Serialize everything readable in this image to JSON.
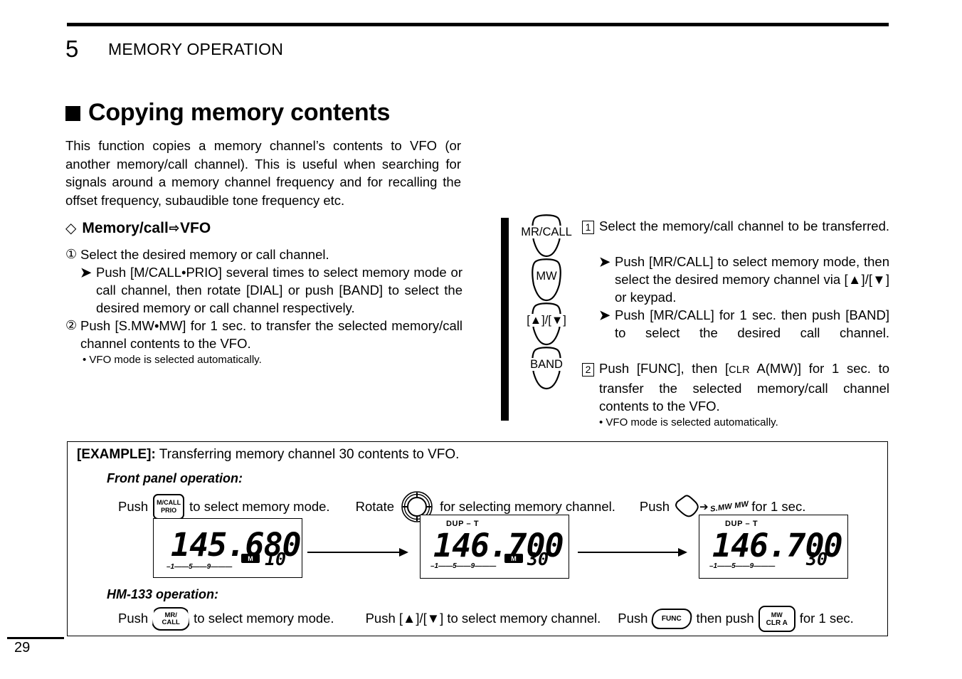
{
  "header": {
    "chapter_number": "5",
    "chapter_title": "MEMORY OPERATION"
  },
  "heading": "Copying memory contents",
  "intro": "This function copies a memory channel’s contents to VFO (or another memory/call channel). This is useful when searching for signals around a memory channel frequency and for recalling the offset frequency, subaudible tone frequency etc.",
  "left_section": {
    "subheading_pre": "Memory/call",
    "subheading_arrow": "⇨",
    "subheading_post": "VFO",
    "diamond": "◇",
    "steps": [
      {
        "num": "①",
        "text": "Select the desired memory or call channel.",
        "sub": [
          "Push [M/CALL•PRIO] several times to select memory mode or call channel, then rotate [DIAL] or push [BAND] to select the desired memory or call channel respectively."
        ]
      },
      {
        "num": "②",
        "text": "Push [S.MW•MW] for 1 sec. to transfer the selected memory/call channel contents to the VFO.",
        "note": "• VFO mode is selected automatically."
      }
    ]
  },
  "keypad_diagram": {
    "keys": [
      {
        "label": "MR/CALL"
      },
      {
        "label": "MW"
      },
      {
        "label": "[▲]/[▼]"
      },
      {
        "label": "BAND"
      }
    ]
  },
  "right_section": {
    "steps": [
      {
        "num": "1",
        "text": "Select the memory/call channel to be transferred.",
        "sub": [
          "Push [MR/CALL] to select memory mode, then select the desired memory channel via [▲]/[▼] or keypad.",
          "Push [MR/CALL] for 1 sec. then push [BAND] to select the desired call channel."
        ]
      },
      {
        "num": "2",
        "text_a": "Push [FUNC], then [",
        "text_clr": "CLR",
        "text_b": " A(MW)] for 1 sec. to transfer the selected memory/call channel contents to the VFO.",
        "note": "• VFO mode is selected automatically."
      }
    ]
  },
  "example": {
    "label": "[EXAMPLE]:",
    "title": " Transferring memory channel 30 contents to VFO.",
    "front_panel_heading": "Front panel operation:",
    "hm133_heading": "HM-133 operation:",
    "front_panel": {
      "push1": "Push",
      "btn_mcall_l1": "M/CALL",
      "btn_mcall_l2": "PRIO",
      "after1": "to select memory mode.",
      "rotate": "Rotate",
      "dial_icon": "dial-icon",
      "after2": "for selecting memory channel.",
      "push2": "Push",
      "smw_label": "S.MW MW",
      "after3": "for 1 sec."
    },
    "hm133": {
      "push1": "Push",
      "btn_mrcall_l1": "MR/",
      "btn_mrcall_l2": "CALL",
      "after1": "to select memory mode.",
      "push2": "Push [▲]/[▼] to select memory channel.",
      "push3": "Push",
      "btn_func": "FUNC",
      "mid": "then push",
      "btn_mw_l1": "MW",
      "btn_mw_l2": "CLR A",
      "after3": "for 1 sec."
    },
    "displays": [
      {
        "dup": "",
        "frequency": "145.680",
        "mode_badge": "M",
        "channel": "10",
        "smeter": "–1——5——9———"
      },
      {
        "dup": "DUP – T",
        "frequency": "146.700",
        "mode_badge": "M",
        "channel": "30",
        "smeter": "–1——5——9———"
      },
      {
        "dup": "DUP – T",
        "frequency": "146.700",
        "mode_badge": "",
        "channel": "30",
        "smeter": "–1——5——9———"
      }
    ]
  },
  "footer": {
    "page_number": "29"
  }
}
